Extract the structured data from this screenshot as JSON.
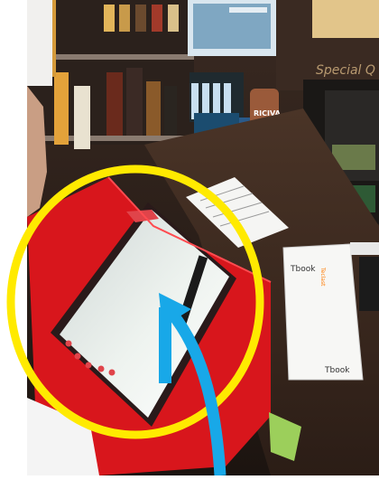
{
  "photo": {
    "description_free": true,
    "overlay_colors": {
      "highlight_circle": "#ffea00",
      "arrow": "#18a8e8"
    },
    "labels": {
      "wall_sign": "Special Q",
      "box_sticker": "RICIVA",
      "tablet_box_brand_top": "Tbook",
      "tablet_box_brand_bottom": "Tbook",
      "tablet_box_side_text": "Teclast"
    }
  }
}
